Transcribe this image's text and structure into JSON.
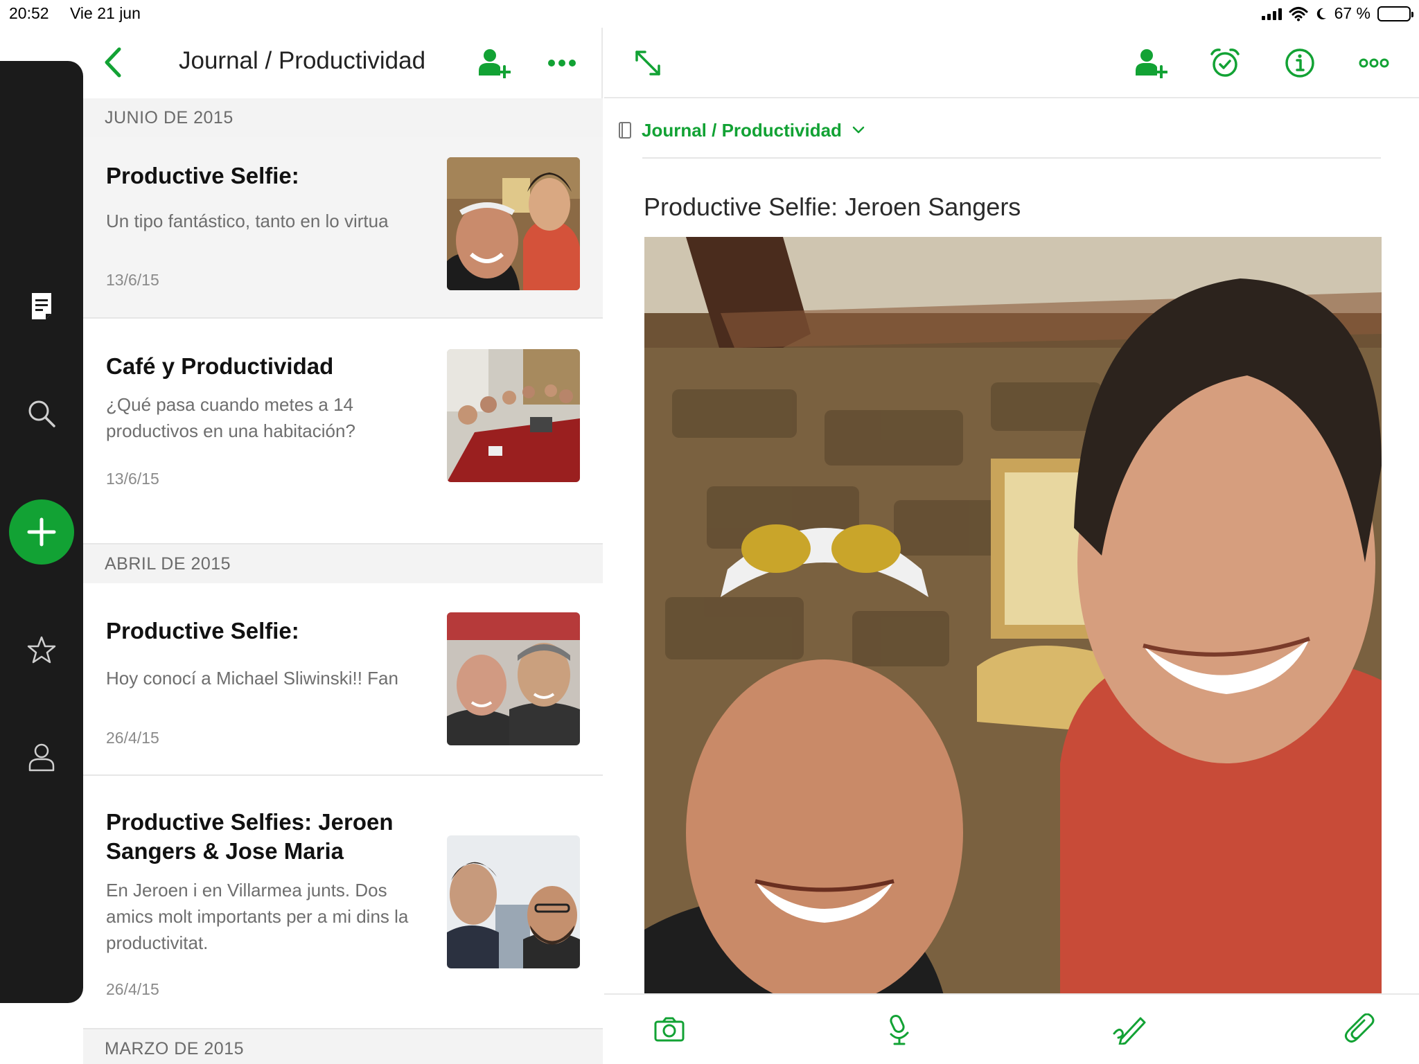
{
  "status_bar": {
    "time": "20:52",
    "date": "Vie 21 jun",
    "battery": "67 %",
    "battery_level": 0.67
  },
  "nav_rail": {
    "items": [
      {
        "name": "notes",
        "icon": "note-icon"
      },
      {
        "name": "search",
        "icon": "search-icon"
      },
      {
        "name": "new-note",
        "icon": "plus-icon"
      },
      {
        "name": "shortcuts",
        "icon": "star-icon"
      },
      {
        "name": "account",
        "icon": "user-icon"
      }
    ]
  },
  "list": {
    "title": "Journal / Productividad",
    "sections": [
      {
        "label": "JUNIO DE 2015"
      },
      {
        "label": "ABRIL DE 2015"
      },
      {
        "label": "MARZO DE 2015"
      }
    ],
    "notes": [
      {
        "title": "Productive Selfie:",
        "snippet": "Un tipo fantástico, tanto en lo virtua",
        "date": "13/6/15"
      },
      {
        "title": "Café y Productividad",
        "snippet": "¿Qué pasa cuando metes a 14 productivos en una habitación?",
        "date": "13/6/15"
      },
      {
        "title": "Productive Selfie:",
        "snippet": "Hoy conocí a Michael Sliwinski!! Fan",
        "date": "26/4/15"
      },
      {
        "title": "Productive Selfies: Jeroen Sangers & Jose Maria",
        "snippet": "En Jeroen i en Villarmea junts. Dos amics molt importants per a mi dins la productivitat.",
        "date": "26/4/15"
      }
    ]
  },
  "detail": {
    "notebook": "Journal / Productividad",
    "title": "Productive Selfie: Jeroen Sangers"
  },
  "colors": {
    "accent": "#12a234",
    "rail": "#1b1b1b"
  }
}
